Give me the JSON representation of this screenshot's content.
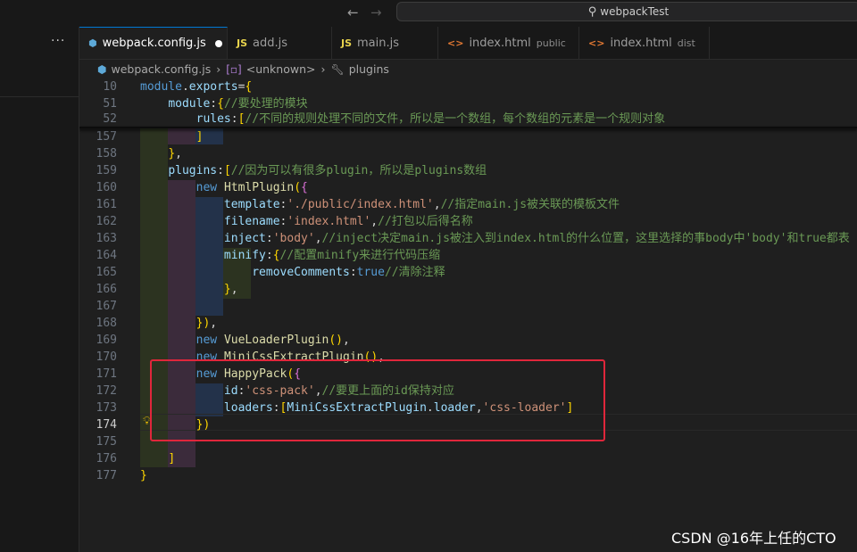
{
  "window": {
    "search_text": "webpackTest"
  },
  "tabs": [
    {
      "icon": "cube-icon",
      "label": "webpack.config.js",
      "desc": "",
      "active": true,
      "dirty": true
    },
    {
      "icon": "JS",
      "label": "add.js",
      "desc": ""
    },
    {
      "icon": "JS",
      "label": "main.js",
      "desc": ""
    },
    {
      "icon": "<>",
      "label": "index.html",
      "desc": "public"
    },
    {
      "icon": "<>",
      "label": "index.html",
      "desc": "dist"
    }
  ],
  "breadcrumb": {
    "file": "webpack.config.js",
    "scope": "<unknown>",
    "symbol": "plugins"
  },
  "editor": {
    "lines": [
      {
        "n": "10",
        "t": "module.exports={"
      },
      {
        "n": "51",
        "t": "    module:{//要处理的模块"
      },
      {
        "n": "52",
        "t": "        rules:[//不同的规则处理不同的文件，所以是一个数组，每个数组的元素是一个规则对象"
      },
      {
        "n": "157",
        "t": "        ]"
      },
      {
        "n": "158",
        "t": "    },"
      },
      {
        "n": "159",
        "t": "    plugins:[//因为可以有很多plugin，所以是plugins数组"
      },
      {
        "n": "160",
        "t": "        new HtmlPlugin({"
      },
      {
        "n": "161",
        "t": "            template:'./public/index.html',//指定main.js被关联的模板文件"
      },
      {
        "n": "162",
        "t": "            filename:'index.html',//打包以后得名称"
      },
      {
        "n": "163",
        "t": "            inject:'body',//inject决定main.js被注入到index.html的什么位置，这里选择的事body中'body'和true都表"
      },
      {
        "n": "164",
        "t": "            minify:{//配置minify来进行代码压缩"
      },
      {
        "n": "165",
        "t": "                removeComments:true//清除注释"
      },
      {
        "n": "166",
        "t": "            },"
      },
      {
        "n": "167",
        "t": ""
      },
      {
        "n": "168",
        "t": "        }),"
      },
      {
        "n": "169",
        "t": "        new VueLoaderPlugin(),"
      },
      {
        "n": "170",
        "t": "        new MiniCssExtractPlugin(),"
      },
      {
        "n": "171",
        "t": "        new HappyPack({"
      },
      {
        "n": "172",
        "t": "            id:'css-pack',//要更上面的id保持对应"
      },
      {
        "n": "173",
        "t": "            loaders:[MiniCssExtractPlugin.loader,'css-loader']"
      },
      {
        "n": "174",
        "t": "        })"
      },
      {
        "n": "175",
        "t": ""
      },
      {
        "n": "176",
        "t": "    ]"
      },
      {
        "n": "177",
        "t": "}"
      }
    ],
    "current_line": "174"
  },
  "watermark": "CSDN @16年上任的CTO",
  "colors": {
    "keyword": "#569cd6",
    "function": "#dcdcaa",
    "property": "#9cdcfe",
    "string": "#ce9178",
    "comment": "#6a9955",
    "highlight_box": "#e0263b"
  }
}
